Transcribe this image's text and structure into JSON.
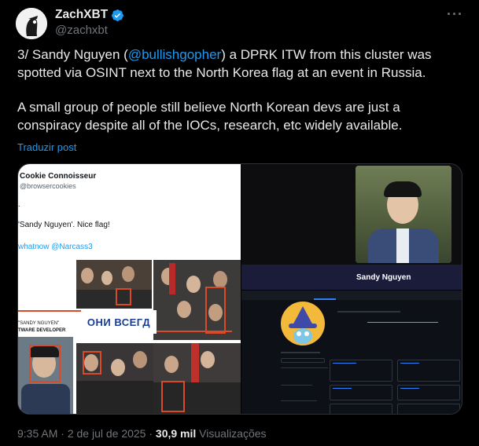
{
  "author": {
    "name": "ZachXBT",
    "handle": "@zachxbt",
    "verified_color": "#1d9bf0"
  },
  "more_icon": "more-horizontal-icon",
  "tweet": {
    "p1_before": "3/ Sandy Nguyen (",
    "p1_mention": "@bullishgopher",
    "p1_after": ") a DPRK ITW from this cluster was spotted via OSINT next to the North Korea flag at an event in Russia.",
    "p2": "A small group of people still believe North Korean devs are just a conspiracy despite all of the IOCs, research, etc widely available.",
    "translate": "Traduzir post",
    "mention_color": "#1d9bf0"
  },
  "media": {
    "left": {
      "account_name": "Cookie Connoisseur",
      "account_handle": "@browsercookies",
      "dot": ".",
      "quote": "'Sandy Nguyen'. Nice flag!",
      "links": "whatnow @Narcass3",
      "banner_text": "ОНИ ВСЕГД",
      "label_line1": "\"SANDY NGUYEN\"",
      "label_line2": "TWARE DEVELOPER"
    },
    "right_top": {
      "name": "Sandy Nguyen"
    }
  },
  "footer": {
    "time": "9:35 AM",
    "separator": " · ",
    "date": "2 de jul de 2025",
    "separator2": " · ",
    "views_count": "30,9 mil",
    "views_label": " Visualizações"
  }
}
